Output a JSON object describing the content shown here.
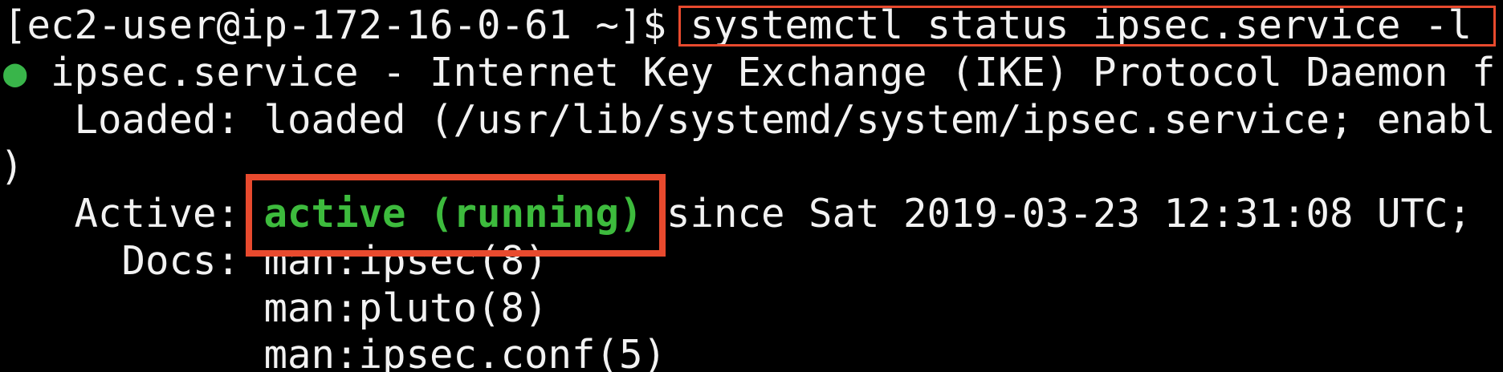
{
  "terminal": {
    "prompt": "[ec2-user@ip-172-16-0-61 ~]$ ",
    "command": "systemctl status ipsec.service -l",
    "bullet": "●",
    "service_line": " ipsec.service - Internet Key Exchange (IKE) Protocol Daemon f",
    "loaded_line": "   Loaded: loaded (/usr/lib/systemd/system/ipsec.service; enabl",
    "wrap_line": ")",
    "active_label": "   Active: ",
    "active_status": "active (running)",
    "active_since": " since Sat 2019-03-23 12:31:08 UTC;",
    "docs_label": "     Docs: ",
    "docs_1": "man:ipsec(8)",
    "docs_indent": "           ",
    "docs_2": "man:pluto(8)",
    "docs_3": "man:ipsec.conf(5)"
  },
  "colors": {
    "background": "#000000",
    "text": "#f2f2f2",
    "status_green": "#3dbb3d",
    "highlight_box": "#e84a2e"
  }
}
